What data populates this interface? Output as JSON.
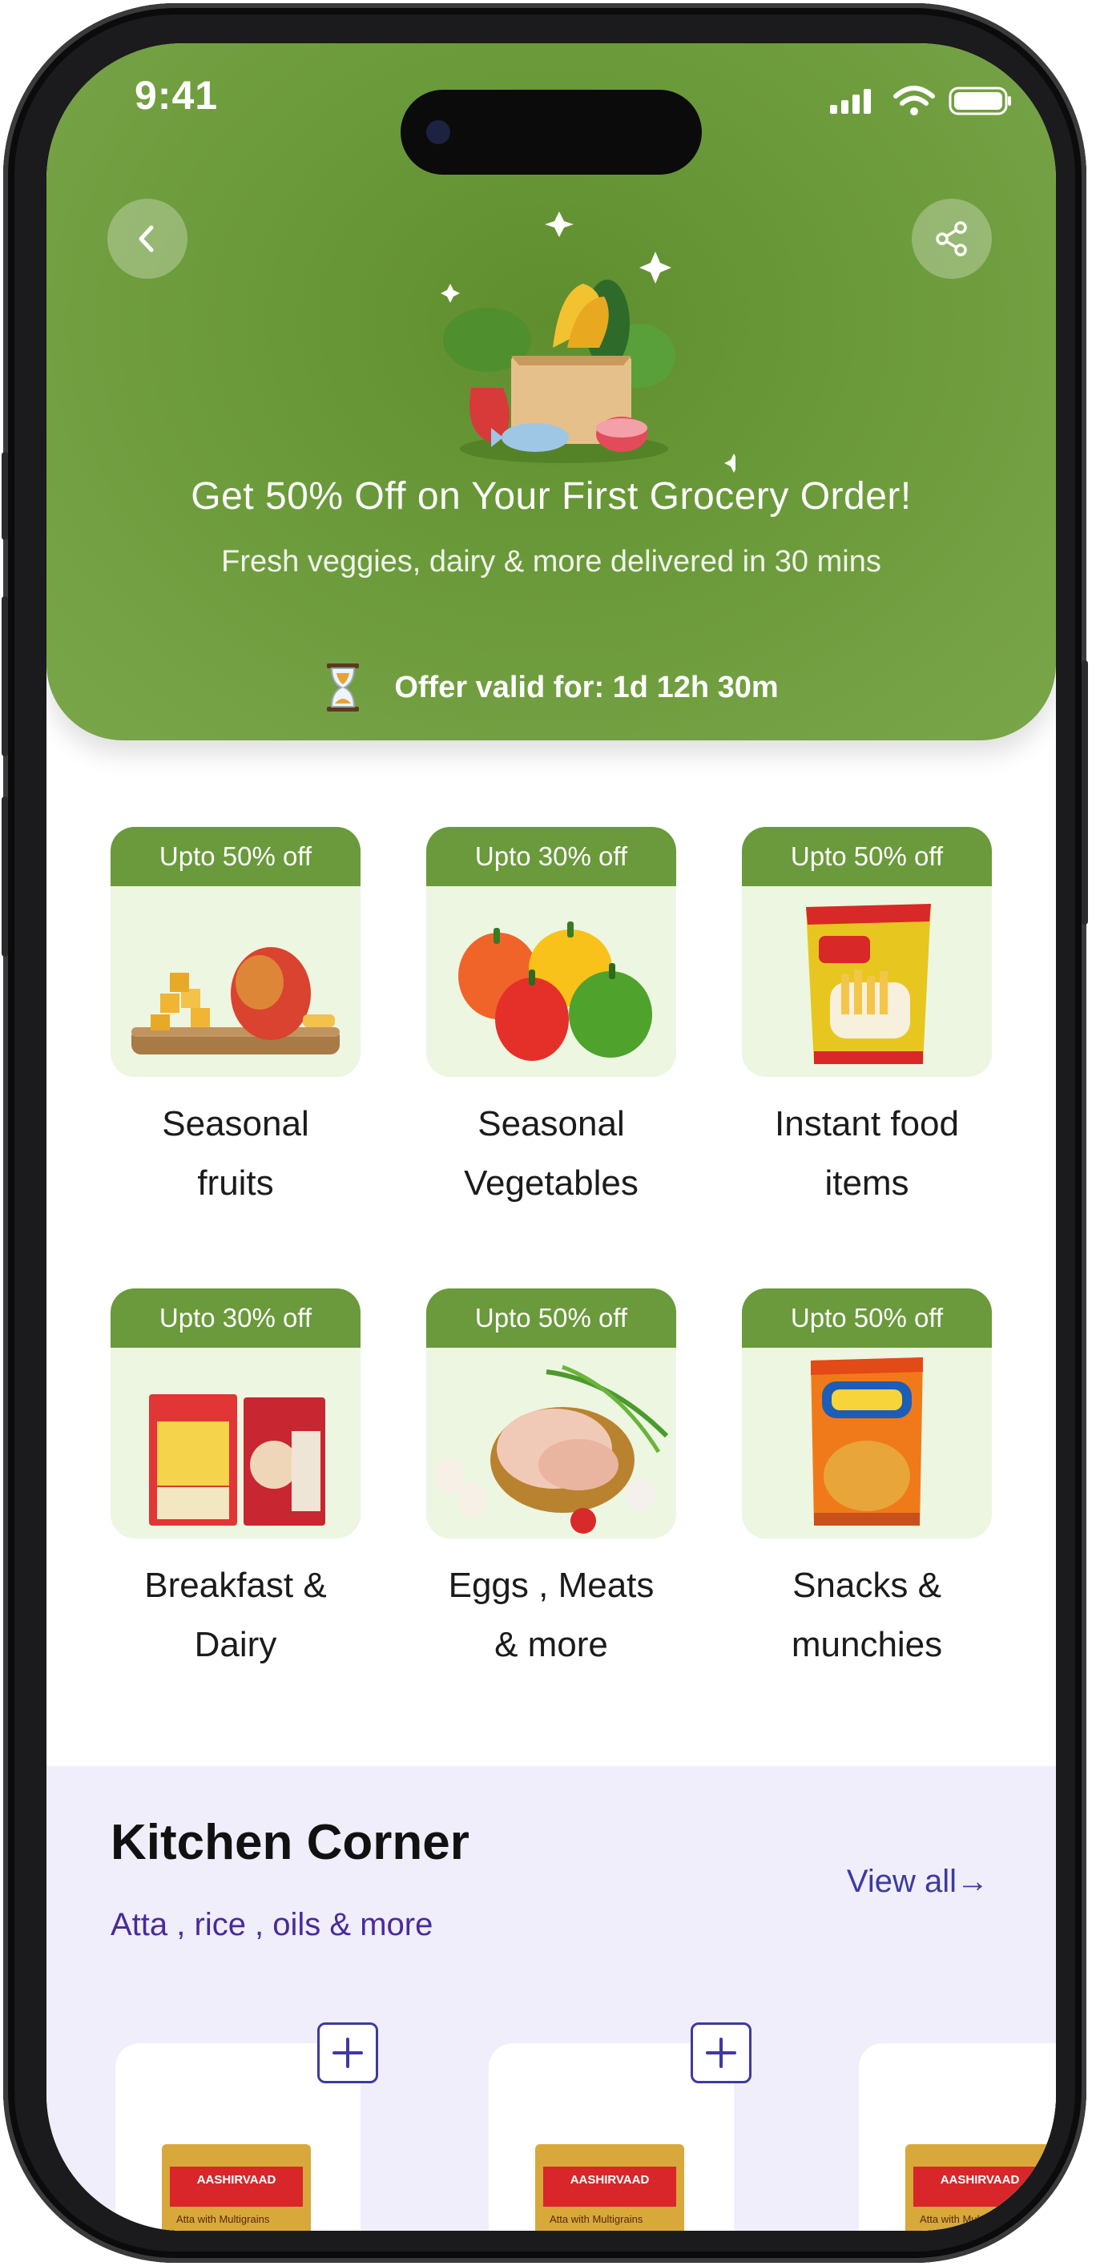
{
  "status_bar": {
    "time": "9:41"
  },
  "hero": {
    "title": "Get 50% Off on Your First Grocery Order!",
    "subtitle": "Fresh veggies, dairy & more delivered in 30 mins",
    "timer_text": "Offer valid for: 1d 12h 30m",
    "bg_color": "#6b9a3a"
  },
  "categories": [
    {
      "badge": "Upto 50% off",
      "line1": "Seasonal",
      "line2": "fruits"
    },
    {
      "badge": "Upto 30% off",
      "line1": "Seasonal",
      "line2": "Vegetables"
    },
    {
      "badge": "Upto 50% off",
      "line1": "Instant food",
      "line2": "items"
    },
    {
      "badge": "Upto 30% off",
      "line1": "Breakfast &",
      "line2": "Dairy"
    },
    {
      "badge": "Upto 50% off",
      "line1": "Eggs , Meats",
      "line2": "& more"
    },
    {
      "badge": "Upto 50% off",
      "line1": "Snacks &",
      "line2": "munchies"
    }
  ],
  "kitchen": {
    "title": "Kitchen Corner",
    "subtitle": "Atta , rice , oils & more",
    "view_all": "View all→",
    "products": [
      {
        "brand": "AASHIRVAAD",
        "variant": "Atta with Multigrains"
      },
      {
        "brand": "AASHIRVAAD",
        "variant": "Atta with Multigrains"
      },
      {
        "brand": "AASHIRVAAD",
        "variant": "Atta with Multigrains"
      }
    ]
  },
  "colors": {
    "accent_green": "#6a9a3b",
    "card_bg": "#ecf6e1",
    "kitchen_bg": "#efeefa",
    "link_purple": "#3c3ba0"
  }
}
